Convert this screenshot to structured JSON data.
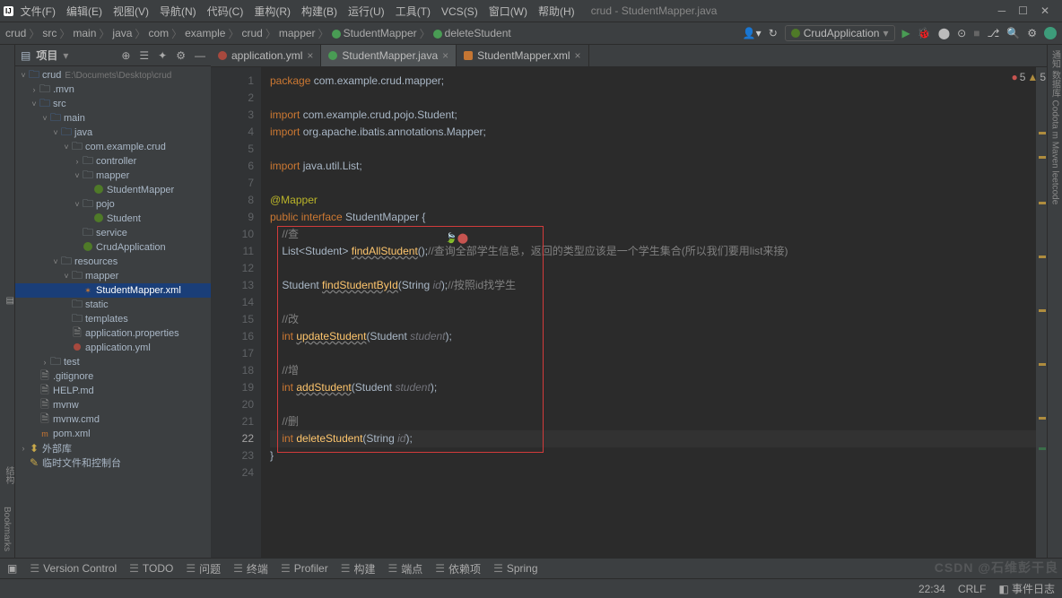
{
  "titlebar": {
    "app_icon": "IJ",
    "menus": [
      "文件(F)",
      "编辑(E)",
      "视图(V)",
      "导航(N)",
      "代码(C)",
      "重构(R)",
      "构建(B)",
      "运行(U)",
      "工具(T)",
      "VCS(S)",
      "窗口(W)",
      "帮助(H)"
    ],
    "title": "crud - StudentMapper.java"
  },
  "breadcrumb": [
    "crud",
    "src",
    "main",
    "java",
    "com",
    "example",
    "crud",
    "mapper",
    "StudentMapper",
    "deleteStudent"
  ],
  "run_config": "CrudApplication",
  "project_pane_title": "项目",
  "tree": [
    {
      "indent": 0,
      "open": true,
      "icon": "folder-blue",
      "label": "crud",
      "suffix": "E:\\Documets\\Desktop\\crud"
    },
    {
      "indent": 1,
      "open": false,
      "icon": "folder",
      "label": ".mvn"
    },
    {
      "indent": 1,
      "open": true,
      "icon": "folder-blue",
      "label": "src"
    },
    {
      "indent": 2,
      "open": true,
      "icon": "folder-blue",
      "label": "main"
    },
    {
      "indent": 3,
      "open": true,
      "icon": "folder-blue",
      "label": "java"
    },
    {
      "indent": 4,
      "open": true,
      "icon": "folder",
      "label": "com.example.crud"
    },
    {
      "indent": 5,
      "open": false,
      "icon": "folder",
      "label": "controller"
    },
    {
      "indent": 5,
      "open": true,
      "icon": "folder",
      "label": "mapper"
    },
    {
      "indent": 6,
      "icon": "class",
      "label": "StudentMapper"
    },
    {
      "indent": 5,
      "open": true,
      "icon": "folder",
      "label": "pojo"
    },
    {
      "indent": 6,
      "icon": "class",
      "label": "Student"
    },
    {
      "indent": 5,
      "icon": "folder",
      "label": "service"
    },
    {
      "indent": 5,
      "icon": "class",
      "label": "CrudApplication"
    },
    {
      "indent": 3,
      "open": true,
      "icon": "folder",
      "label": "resources"
    },
    {
      "indent": 4,
      "open": true,
      "icon": "folder",
      "label": "mapper"
    },
    {
      "indent": 5,
      "icon": "xml",
      "label": "StudentMapper.xml",
      "selected": true
    },
    {
      "indent": 4,
      "icon": "folder",
      "label": "static"
    },
    {
      "indent": 4,
      "icon": "folder",
      "label": "templates"
    },
    {
      "indent": 4,
      "icon": "file",
      "label": "application.properties"
    },
    {
      "indent": 4,
      "icon": "yml",
      "label": "application.yml"
    },
    {
      "indent": 2,
      "open": false,
      "icon": "folder",
      "label": "test"
    },
    {
      "indent": 1,
      "icon": "file",
      "label": ".gitignore"
    },
    {
      "indent": 1,
      "icon": "file",
      "label": "HELP.md"
    },
    {
      "indent": 1,
      "icon": "file",
      "label": "mvnw"
    },
    {
      "indent": 1,
      "icon": "file",
      "label": "mvnw.cmd"
    },
    {
      "indent": 1,
      "icon": "pom",
      "label": "pom.xml"
    },
    {
      "indent": 0,
      "open": false,
      "icon": "lib",
      "label": "外部库"
    },
    {
      "indent": 0,
      "icon": "scratch",
      "label": "临时文件和控制台"
    }
  ],
  "tabs": [
    {
      "label": "application.yml",
      "icon": "yml"
    },
    {
      "label": "StudentMapper.java",
      "icon": "java",
      "active": true
    },
    {
      "label": "StudentMapper.xml",
      "icon": "xml"
    }
  ],
  "errors": {
    "red": 5,
    "yellow": 5
  },
  "code_lines": [
    {
      "n": 1,
      "segs": [
        {
          "c": "kw",
          "t": "package "
        },
        {
          "c": "ident",
          "t": "com.example.crud.mapper;"
        }
      ]
    },
    {
      "n": 2,
      "segs": []
    },
    {
      "n": 3,
      "segs": [
        {
          "c": "kw",
          "t": "import "
        },
        {
          "c": "ident",
          "t": "com.example.crud.pojo.Student;"
        }
      ]
    },
    {
      "n": 4,
      "segs": [
        {
          "c": "kw",
          "t": "import "
        },
        {
          "c": "ident",
          "t": "org.apache.ibatis.annotations.Mapper;"
        }
      ]
    },
    {
      "n": 5,
      "segs": []
    },
    {
      "n": 6,
      "segs": [
        {
          "c": "kw",
          "t": "import "
        },
        {
          "c": "ident",
          "t": "java.util.List;"
        }
      ]
    },
    {
      "n": 7,
      "segs": []
    },
    {
      "n": 8,
      "segs": [
        {
          "c": "ann",
          "t": "@Mapper"
        }
      ]
    },
    {
      "n": 9,
      "segs": [
        {
          "c": "kw",
          "t": "public interface "
        },
        {
          "c": "ident",
          "t": "StudentMapper {"
        }
      ],
      "impl": true
    },
    {
      "n": 10,
      "segs": [
        {
          "c": "ident",
          "t": "    "
        },
        {
          "c": "comment",
          "t": "//查"
        }
      ]
    },
    {
      "n": 11,
      "segs": [
        {
          "c": "ident",
          "t": "    List<Student> "
        },
        {
          "c": "method underline",
          "t": "findAllStudent"
        },
        {
          "c": "ident",
          "t": "();"
        },
        {
          "c": "comment",
          "t": "//查询全部学生信息，返回的类型应该是一个学生集合(所以我们要用list来接)"
        }
      ]
    },
    {
      "n": 12,
      "segs": []
    },
    {
      "n": 13,
      "segs": [
        {
          "c": "ident",
          "t": "    Student "
        },
        {
          "c": "method underline",
          "t": "findStudentById"
        },
        {
          "c": "ident",
          "t": "(String "
        },
        {
          "c": "param",
          "t": "id"
        },
        {
          "c": "ident",
          "t": ");"
        },
        {
          "c": "comment",
          "t": "//按照id找学生"
        }
      ]
    },
    {
      "n": 14,
      "segs": []
    },
    {
      "n": 15,
      "segs": [
        {
          "c": "ident",
          "t": "    "
        },
        {
          "c": "comment",
          "t": "//改"
        }
      ]
    },
    {
      "n": 16,
      "segs": [
        {
          "c": "ident",
          "t": "    "
        },
        {
          "c": "kw",
          "t": "int "
        },
        {
          "c": "method underline",
          "t": "updateStudent"
        },
        {
          "c": "ident",
          "t": "(Student "
        },
        {
          "c": "param",
          "t": "student"
        },
        {
          "c": "ident",
          "t": ");"
        }
      ]
    },
    {
      "n": 17,
      "segs": []
    },
    {
      "n": 18,
      "segs": [
        {
          "c": "ident",
          "t": "    "
        },
        {
          "c": "comment",
          "t": "//增"
        }
      ]
    },
    {
      "n": 19,
      "segs": [
        {
          "c": "ident",
          "t": "    "
        },
        {
          "c": "kw",
          "t": "int "
        },
        {
          "c": "method underline",
          "t": "addStudent"
        },
        {
          "c": "ident",
          "t": "(Student "
        },
        {
          "c": "param",
          "t": "student"
        },
        {
          "c": "ident",
          "t": ");"
        }
      ]
    },
    {
      "n": 20,
      "segs": []
    },
    {
      "n": 21,
      "segs": [
        {
          "c": "ident",
          "t": "    "
        },
        {
          "c": "comment",
          "t": "//删"
        }
      ]
    },
    {
      "n": 22,
      "current": true,
      "segs": [
        {
          "c": "ident",
          "t": "    "
        },
        {
          "c": "kw",
          "t": "int "
        },
        {
          "c": "method",
          "t": "deleteStudent"
        },
        {
          "c": "ident",
          "t": "(String "
        },
        {
          "c": "param",
          "t": "id"
        },
        {
          "c": "ident",
          "t": ");"
        }
      ]
    },
    {
      "n": 23,
      "segs": [
        {
          "c": "ident",
          "t": "}"
        }
      ]
    },
    {
      "n": 24,
      "segs": []
    }
  ],
  "bottom_bar": [
    "Version Control",
    "TODO",
    "问题",
    "终端",
    "Profiler",
    "构建",
    "端点",
    "依赖项",
    "Spring"
  ],
  "status": {
    "pos": "22:34",
    "branch": "CRLF",
    "events": "事件日志"
  },
  "watermark": "CSDN @石维彭干良",
  "left_bar_label": "结构",
  "left_bar_label2": "Bookmarks"
}
